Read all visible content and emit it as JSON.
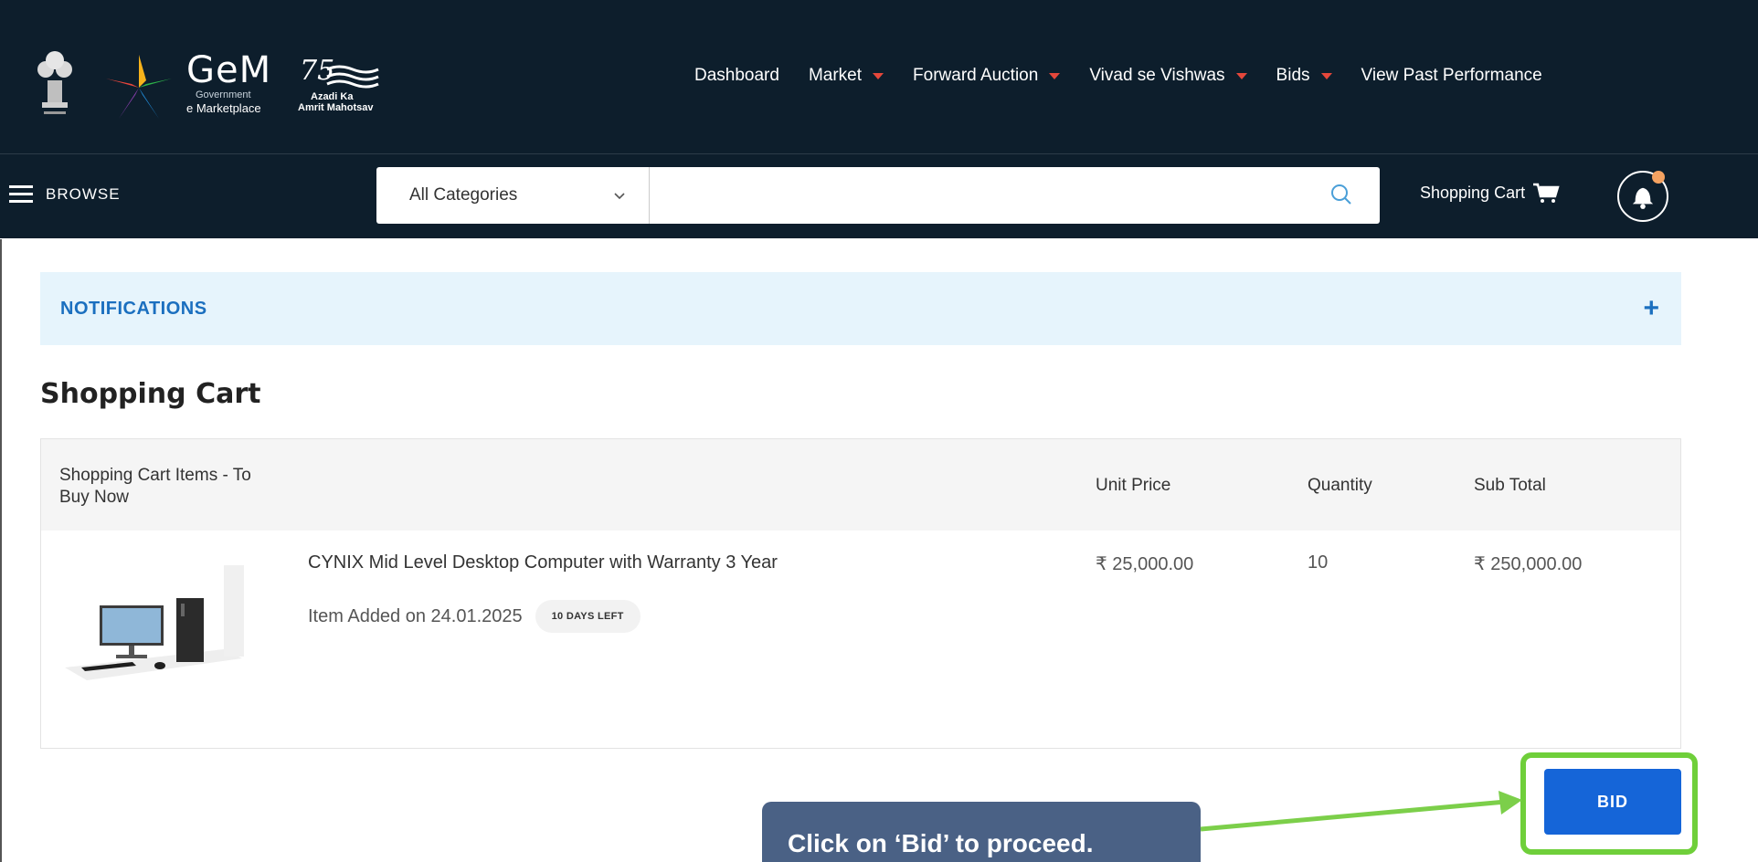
{
  "brand": {
    "name": "GeM",
    "line1": "Government",
    "line2": "e Marketplace",
    "azadi_number": "75",
    "azadi_line1": "Azadi Ka",
    "azadi_line2": "Amrit Mahotsav"
  },
  "nav": {
    "items": [
      {
        "label": "Dashboard",
        "dropdown": false
      },
      {
        "label": "Market",
        "dropdown": true
      },
      {
        "label": "Forward Auction",
        "dropdown": true
      },
      {
        "label": "Vivad se Vishwas",
        "dropdown": true
      },
      {
        "label": "Bids",
        "dropdown": true
      },
      {
        "label": "View Past Performance",
        "dropdown": false
      }
    ]
  },
  "search": {
    "browse_label": "BROWSE",
    "category_selected": "All Categories",
    "placeholder": "",
    "cart_label": "Shopping Cart"
  },
  "notifications": {
    "title": "NOTIFICATIONS",
    "expand": "+"
  },
  "cart": {
    "heading": "Shopping Cart",
    "columns": {
      "items": "Shopping Cart Items - To Buy Now",
      "unit_price": "Unit Price",
      "quantity": "Quantity",
      "sub_total": "Sub Total"
    },
    "item": {
      "name": "CYNIX Mid Level Desktop Computer with Warranty 3 Year",
      "added": "Item Added on 24.01.2025",
      "days_left": "10 DAYS LEFT",
      "unit_price": "₹ 25,000.00",
      "quantity": "10",
      "sub_total": "₹ 250,000.00"
    },
    "bid_label": "BID"
  },
  "callout": {
    "text": "Click on ‘Bid’ to proceed."
  },
  "colors": {
    "header_bg": "#0d1e2c",
    "accent_red": "#e5473b",
    "primary_blue": "#1565d8",
    "highlight_green": "#6fcf3a",
    "callout_bg": "#4a6185"
  }
}
